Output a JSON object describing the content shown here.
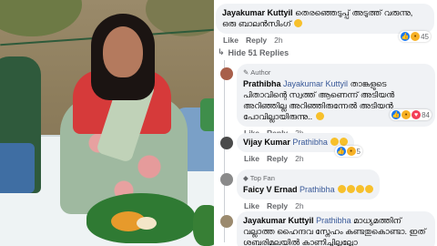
{
  "comments": [
    {
      "author": "",
      "text": "തെരഞ്ഞെടുപ്പ് അടുത്ത് വരുന്നു, ഒരു ബാലൻസിംഗ്",
      "like": "Like",
      "reply": "Reply",
      "time": "2h",
      "reaction_count": "45"
    },
    {
      "author": "Prathibha",
      "badge": "Author",
      "mention": "Jayakumar Kuttyil",
      "text": "താങ്കളുടെ പിതാവിന്റെ സ്വത്ത് ആണെന്ന് അടിയൻ അറിഞ്ഞില്ല അറിഞ്ഞിരുന്നേൽ അടിയൻ പോവില്ലായിരുന്നു..",
      "like": "Like",
      "reply": "Reply",
      "time": "2h",
      "reaction_count": "84"
    },
    {
      "author": "Vijay Kumar",
      "mention": "Prathibha",
      "text": "",
      "like": "Like",
      "reply": "Reply",
      "time": "2h",
      "reaction_count": "5"
    },
    {
      "author": "Faicy V Ernad",
      "badge": "Top Fan",
      "mention": "Prathibha",
      "text": "",
      "like": "Like",
      "reply": "Reply",
      "time": "2h"
    },
    {
      "author": "Jayakumar Kuttyil",
      "mention": "Prathibha",
      "text": "മാധ്യമത്തിന് വല്ലാത്ത ഹൈന്ദവ സ്നേഹം കണ്ടതുകൊണ്ടാ. ഇത് ശബരിമലയിൽ കാണിച്ചില്ലല്ലോ"
    }
  ],
  "first_comment_author": "Jayakumar Kuttyil",
  "hide_replies_label": "Hide 51 Replies",
  "colors": {
    "bubble": "#f0f2f5",
    "meta": "#65676b",
    "like_blue": "#1877f2"
  }
}
